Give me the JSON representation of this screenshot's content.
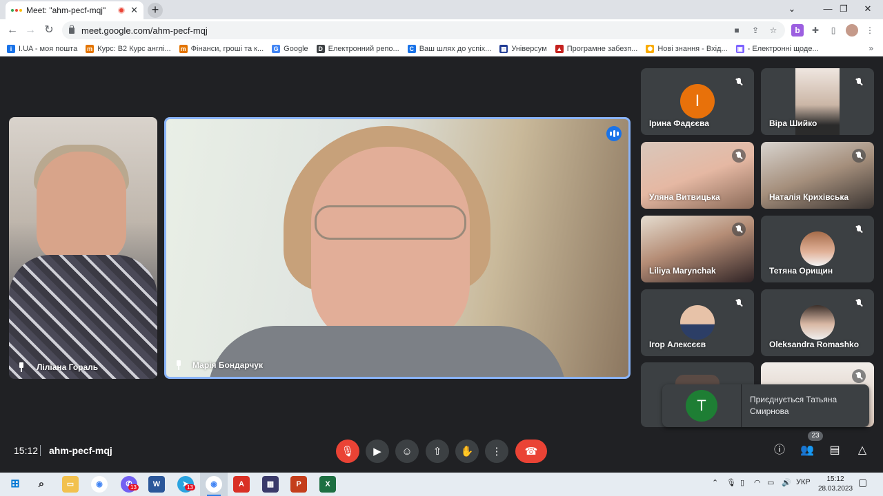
{
  "browser": {
    "tab_title": "Meet: \"ahm-pecf-mqj\"",
    "tab_close": "✕",
    "new_tab": "+",
    "window_controls": [
      "⌄",
      "—",
      "❐",
      "✕"
    ],
    "url": "meet.google.com/ahm-pecf-mqj",
    "bookmarks": [
      {
        "label": "I.UA - моя пошта",
        "icon_color": "#1a73e8",
        "icon": "i"
      },
      {
        "label": "Курс: B2 Курс англі...",
        "icon_color": "#e37400",
        "icon": "m"
      },
      {
        "label": "Фінанси, гроші та к...",
        "icon_color": "#e37400",
        "icon": "m"
      },
      {
        "label": "Google",
        "icon_color": "#4285f4",
        "icon": "G"
      },
      {
        "label": "Електронний репо...",
        "icon_color": "#3c4043",
        "icon": "D"
      },
      {
        "label": "Ваш шлях до успіх...",
        "icon_color": "#1a73e8",
        "icon": "C"
      },
      {
        "label": "Універсум",
        "icon_color": "#1f3a93",
        "icon": "▦"
      },
      {
        "label": "Програмне забезп...",
        "icon_color": "#c5221f",
        "icon": "▲"
      },
      {
        "label": "Нові знання - Вхід...",
        "icon_color": "#f9ab00",
        "icon": "✺"
      },
      {
        "label": "- Електронні щоде...",
        "icon_color": "#7b61ff",
        "icon": "▣"
      }
    ],
    "bookmarks_more": "»"
  },
  "meeting": {
    "pinned": [
      {
        "name": "Ліліана Гораль"
      },
      {
        "name": "Марія Бондарчук"
      }
    ],
    "grid": [
      {
        "name": "Ірина Фадєєва",
        "initial": "І",
        "avatar_color": "#e8710a"
      },
      {
        "name": "Віра Шийко"
      },
      {
        "name": "Уляна Витвицька"
      },
      {
        "name": "Наталія Крихівська"
      },
      {
        "name": "Liliya Marynchak"
      },
      {
        "name": "Тетяна Орищин"
      },
      {
        "name": "Ігор Алексєєв"
      },
      {
        "name": "Oleksandra Romashko"
      }
    ],
    "notification": {
      "initial": "T",
      "text": "Приєднується Татьяна Смирнова"
    },
    "time": "15:12",
    "code": "ahm-pecf-mqj",
    "participant_count": "23"
  },
  "taskbar": {
    "language": "УКР",
    "time": "15:12",
    "date": "28.03.2023",
    "badge_viber": "13",
    "badge_telegram": "13"
  }
}
